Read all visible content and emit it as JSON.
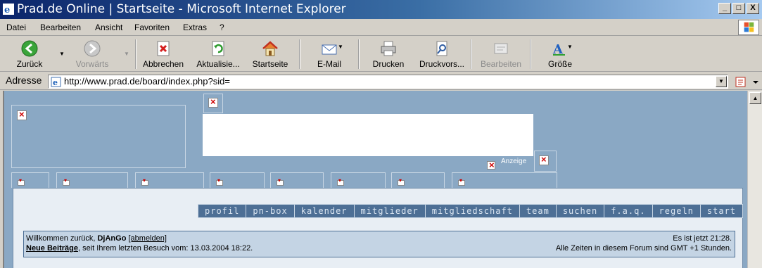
{
  "window": {
    "title": "Prad.de Online | Startseite - Microsoft Internet Explorer",
    "buttons": {
      "minimize": "_",
      "maximize": "□",
      "close": "X"
    }
  },
  "menu": [
    "Datei",
    "Bearbeiten",
    "Ansicht",
    "Favoriten",
    "Extras",
    "?"
  ],
  "toolbar": {
    "back": "Zurück",
    "forward": "Vorwärts",
    "stop": "Abbrechen",
    "refresh": "Aktualisie...",
    "home": "Startseite",
    "mail": "E-Mail",
    "print": "Drucken",
    "print_preview": "Druckvors...",
    "edit": "Bearbeiten",
    "size": "Größe"
  },
  "address": {
    "label": "Adresse",
    "url": "http://www.prad.de/board/index.php?sid="
  },
  "page": {
    "ad_label": "Anzeige",
    "nav_links": [
      "profil",
      "pn-box",
      "kalender",
      "mitglieder",
      "mitgliedschaft",
      "team",
      "suchen",
      "f.a.q.",
      "regeln",
      "start"
    ],
    "welcome": {
      "greeting": "Willkommen zurück,",
      "username": "DjAnGo",
      "logout": "[abmelden]",
      "new_posts": "Neue Beiträge",
      "last_visit": ", seit Ihrem letzten Besuch vom: 13.03.2004 18:22.",
      "current_time": "Es ist jetzt 21:28.",
      "timezone": "Alle Zeiten in diesem Forum sind GMT +1 Stunden."
    }
  },
  "colors": {
    "page_bg": "#8aa8c4",
    "nav_link_bg": "#4d6f95",
    "welcome_bg": "#c4d4e4"
  }
}
